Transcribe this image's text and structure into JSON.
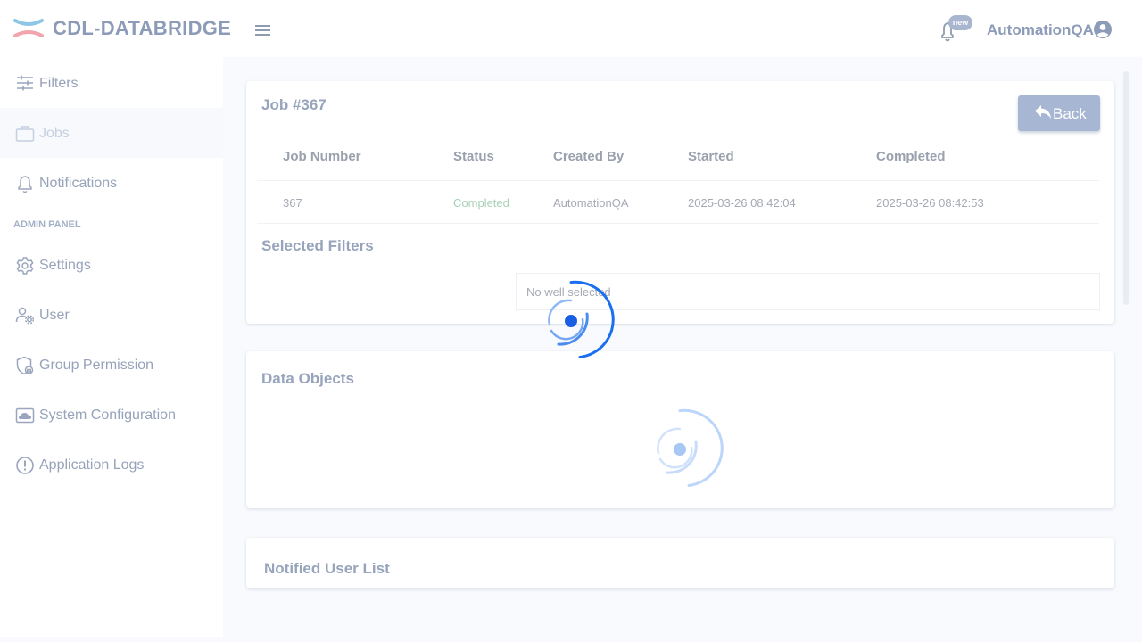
{
  "app": {
    "brand": "CDL-DATABRIDGE"
  },
  "header": {
    "badge": "new",
    "user_name": "AutomationQA"
  },
  "sidebar": {
    "items": [
      {
        "label": "Filters"
      },
      {
        "label": "Jobs"
      },
      {
        "label": "Notifications"
      }
    ],
    "admin_header": "ADMIN PANEL",
    "admin_items": [
      {
        "label": "Settings"
      },
      {
        "label": "User"
      },
      {
        "label": "Group Permission"
      },
      {
        "label": "System Configuration"
      },
      {
        "label": "Application Logs"
      }
    ]
  },
  "job": {
    "title": "Job #367",
    "back_label": "Back",
    "columns": [
      "Job Number",
      "Status",
      "Created By",
      "Started",
      "Completed"
    ],
    "row": {
      "job_number": "367",
      "status": "Completed",
      "created_by": "AutomationQA",
      "started": "2025-03-26 08:42:04",
      "completed": "2025-03-26 08:42:53"
    },
    "selected_filters_title": "Selected Filters",
    "filters_placeholder": "No well selected"
  },
  "data_objects": {
    "title": "Data Objects"
  },
  "notified_users": {
    "title": "Notified User List"
  },
  "colors": {
    "accent": "#1a6ff0",
    "brand_text": "#8c9bb7",
    "status_completed": "#a7d0b7"
  }
}
